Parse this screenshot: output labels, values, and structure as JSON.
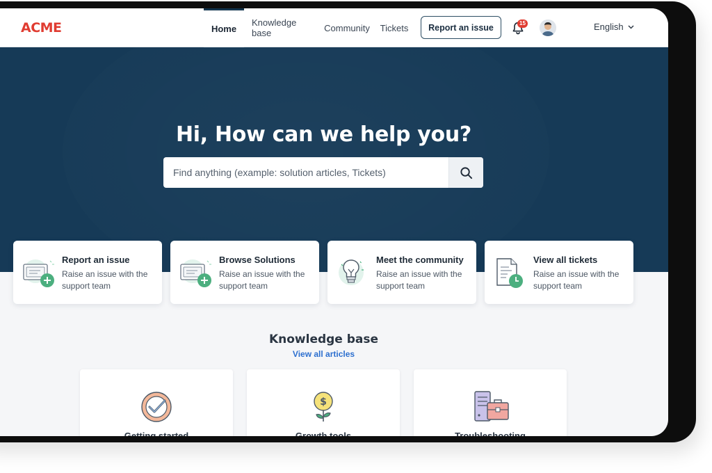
{
  "header": {
    "logo": "ACME",
    "nav": [
      {
        "label": "Home",
        "active": true
      },
      {
        "label": "Knowledge base",
        "active": false
      },
      {
        "label": "Community",
        "active": false
      },
      {
        "label": "Tickets",
        "active": false
      }
    ],
    "report_button": "Report an issue",
    "notification_count": "15",
    "language": "English"
  },
  "hero": {
    "title": "Hi, How can we help you?",
    "search_placeholder": "Find anything (example: solution articles, Tickets)"
  },
  "cards": [
    {
      "title": "Report an issue",
      "desc_line1": "Raise an issue with the",
      "desc_line2": "support team",
      "icon": "ticket-add-icon"
    },
    {
      "title": "Browse Solutions",
      "desc_line1": "Raise an issue with the",
      "desc_line2": "support team",
      "icon": "ticket-add-icon"
    },
    {
      "title": "Meet the community",
      "desc_line1": "Raise an issue with the",
      "desc_line2": "support team",
      "icon": "lightbulb-icon"
    },
    {
      "title": "View all tickets",
      "desc_line1": "Raise an issue with the",
      "desc_line2": "support team",
      "icon": "document-clock-icon"
    }
  ],
  "knowledge_base": {
    "title": "Knowledge base",
    "link": "View all articles",
    "categories": [
      {
        "label": "Getting started",
        "icon": "clock-check-icon"
      },
      {
        "label": "Growth tools",
        "icon": "money-plant-icon"
      },
      {
        "label": "Troubleshooting",
        "icon": "server-toolbox-icon"
      }
    ]
  },
  "colors": {
    "brand": "#e03c31",
    "hero_bg": "#163a57",
    "link": "#2c6fcf",
    "accent_green": "#4caf7f"
  }
}
